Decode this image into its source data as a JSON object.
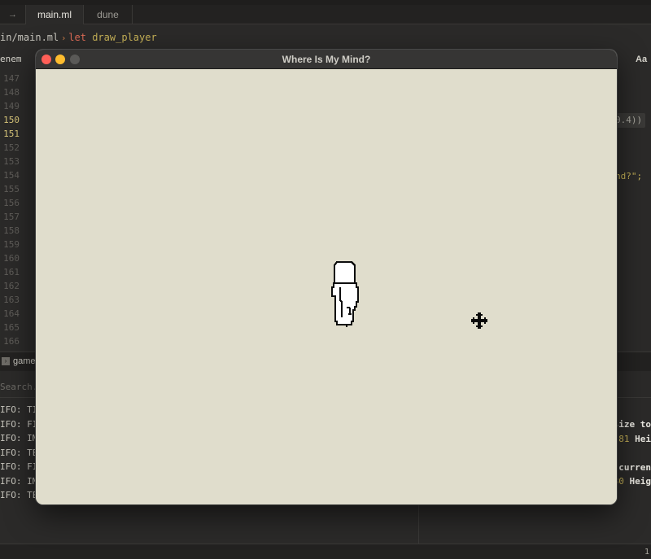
{
  "editor": {
    "tabs": [
      {
        "label": "→"
      },
      {
        "label": "main.ml"
      },
      {
        "label": "dune"
      }
    ],
    "breadcrumb": {
      "path": "in/main.ml",
      "separator": "›",
      "keyword": "let",
      "symbol": "draw_player"
    },
    "outline_left": "enem",
    "outline_right": "Aa",
    "line_numbers": [
      "147",
      "148",
      "149",
      "150",
      "151",
      "152",
      "153",
      "154",
      "155",
      "156",
      "157",
      "158",
      "159",
      "160",
      "161",
      "162",
      "163",
      "164",
      "165",
      "166"
    ],
    "current_lines": [
      "150",
      "151"
    ],
    "code_fragments": [
      "0.4))",
      "nd?\";"
    ]
  },
  "panel": {
    "tab_label": "game",
    "search_placeholder": "Search...",
    "log_lines": [
      "IFO: TIM",
      "IFO: FIL",
      "IFO: IMA",
      "IFO: TEX",
      "IFO: FIL",
      "IFO: IMA",
      "IFO: TEX"
    ],
    "right_lines": [
      {
        "text": "size to",
        "num": ""
      },
      {
        "text": "Hei",
        "num": "81"
      },
      {
        "text": "curren",
        "num": ""
      },
      {
        "text": "Heig",
        "num": "80"
      }
    ]
  },
  "statusbar": {
    "right": "1"
  },
  "game_window": {
    "title": "Where Is My Mind?",
    "background_color": "#e0ddcc"
  }
}
